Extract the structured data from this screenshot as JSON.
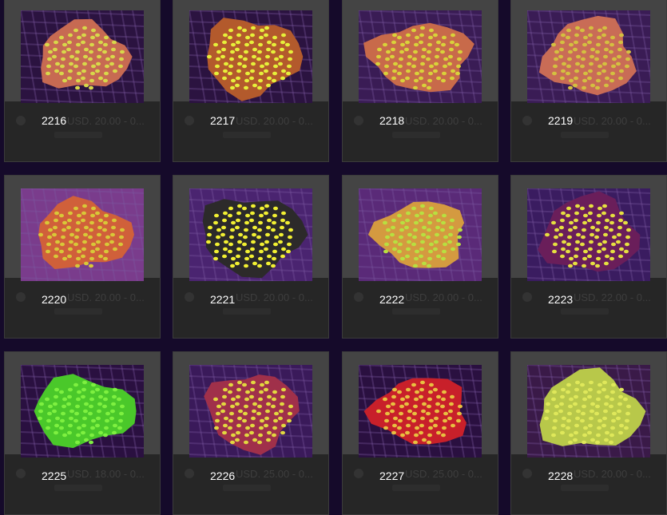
{
  "items": [
    {
      "label": "2216",
      "price": "USD. 20.00 - 0...",
      "colors": {
        "base": "#c76a52",
        "spot": "#d8d84a",
        "bg": "#2b1340"
      }
    },
    {
      "label": "2217",
      "price": "USD. 20.00 - 0...",
      "colors": {
        "base": "#b35a2c",
        "spot": "#e6f03a",
        "bg": "#2b1340"
      }
    },
    {
      "label": "2218",
      "price": "USD. 20.00 - 0...",
      "colors": {
        "base": "#c86a4a",
        "spot": "#d9d23a",
        "bg": "#3a1c55"
      }
    },
    {
      "label": "2219",
      "price": "USD. 20.00 - 0...",
      "colors": {
        "base": "#c96c56",
        "spot": "#d4c040",
        "bg": "#3a1c55"
      }
    },
    {
      "label": "2220",
      "price": "USD. 20.00 - 0...",
      "colors": {
        "base": "#d0603a",
        "spot": "#d8c838",
        "bg": "#7a3c8c"
      }
    },
    {
      "label": "2221",
      "price": "USD. 20.00 - 0...",
      "colors": {
        "base": "#2c2a2a",
        "spot": "#f2f032",
        "bg": "#4a2470"
      }
    },
    {
      "label": "2222",
      "price": "USD. 20.00 - 0...",
      "colors": {
        "base": "#d49a40",
        "spot": "#b8e040",
        "bg": "#5a2a78"
      }
    },
    {
      "label": "2223",
      "price": "USD. 22.00 - 0...",
      "colors": {
        "base": "#6a1e5a",
        "spot": "#e6e040",
        "bg": "#3a1c60"
      }
    },
    {
      "label": "2225",
      "price": "USD. 18.00 - 0...",
      "colors": {
        "base": "#4ac82a",
        "spot": "#7ef040",
        "bg": "#2a1040"
      }
    },
    {
      "label": "2226",
      "price": "USD. 25.00 - 0...",
      "colors": {
        "base": "#a0304a",
        "spot": "#e2d840",
        "bg": "#3a1a5a"
      }
    },
    {
      "label": "2227",
      "price": "USD. 25.00 - 0...",
      "colors": {
        "base": "#c8202a",
        "spot": "#e8c040",
        "bg": "#2a1040"
      }
    },
    {
      "label": "2228",
      "price": "USD. 20.00 - 0...",
      "colors": {
        "base": "#b8c84a",
        "spot": "#dfe85a",
        "bg": "#3a1a48"
      }
    }
  ]
}
